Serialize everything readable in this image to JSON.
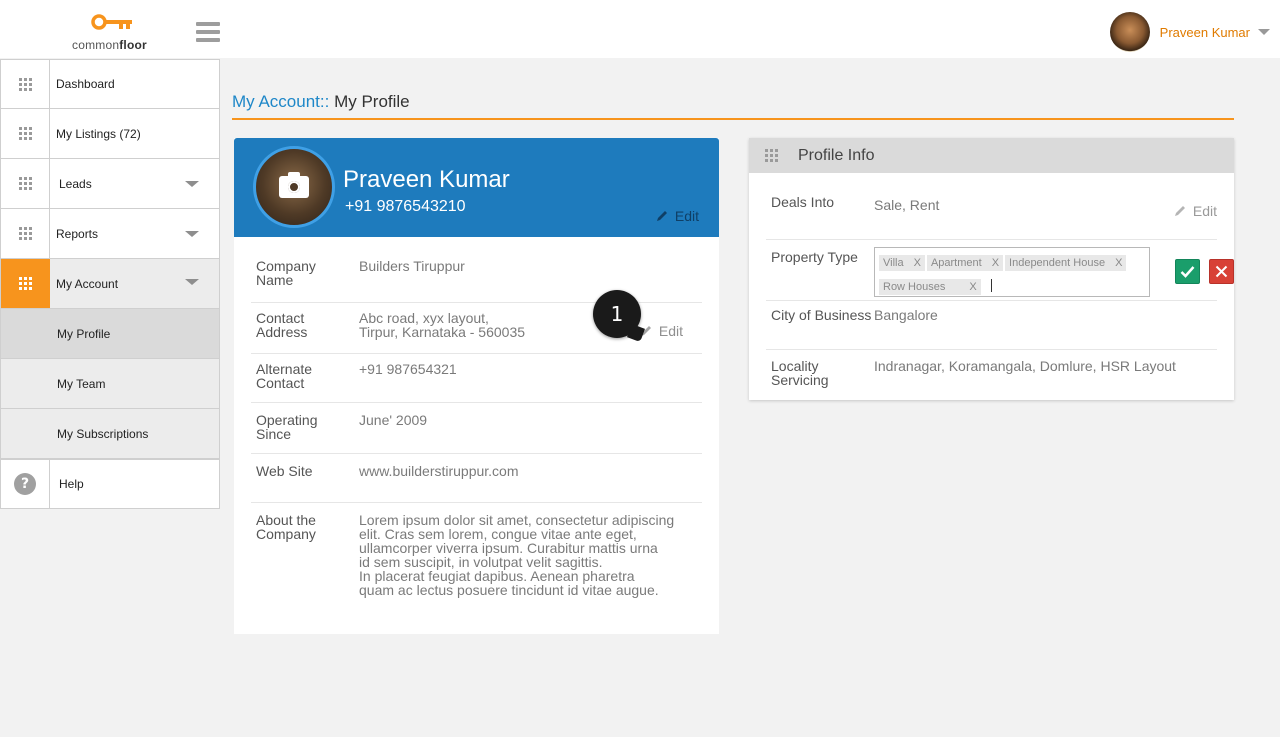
{
  "brand": {
    "logo_prefix": "common",
    "logo_suffix": "floor",
    "accent": "#f7941d",
    "primary": "#1e7bbd"
  },
  "user": {
    "name": "Praveen Kumar"
  },
  "sidebar": {
    "items": [
      {
        "label": "Dashboard",
        "icon": "grid-icon"
      },
      {
        "label": "My Listings (72)",
        "icon": "grid-icon"
      },
      {
        "label": "Leads",
        "icon": "grid-icon"
      },
      {
        "label": "Reports",
        "icon": "grid-icon"
      },
      {
        "label": "My Account",
        "icon": "grid-icon"
      }
    ],
    "subitems": [
      "My Profile",
      "My Team",
      "My Subscriptions"
    ],
    "help": {
      "label": "Help",
      "icon_glyph": "?"
    }
  },
  "page": {
    "crumb": "My Account::",
    "title": "My Profile"
  },
  "profile": {
    "name": "Praveen Kumar",
    "phone": "+91 9876543210",
    "edit_label": "Edit",
    "rows": [
      {
        "label": "Company Name",
        "value": [
          "Builders Tiruppur"
        ]
      },
      {
        "label": "Contact Address",
        "value": [
          "Abc road, xyx layout,",
          "Tirpur, Karnataka - 560035"
        ]
      },
      {
        "label": "Alternate Contact",
        "value": [
          "+91 987654321"
        ]
      },
      {
        "label": "Operating Since",
        "value": [
          "June' 2009"
        ]
      },
      {
        "label": "Web Site",
        "value": [
          "www.builderstiruppur.com"
        ]
      },
      {
        "label": "About the Company",
        "value": [
          "Lorem ipsum dolor sit amet, consectetur adipiscing",
          "elit. Cras sem lorem, congue vitae ante eget,",
          "ullamcorper viverra ipsum. Curabitur mattis urna",
          "id sem suscipit, in volutpat velit sagittis.",
          "In placerat feugiat dapibus. Aenean pharetra",
          "quam ac lectus posuere tincidunt id vitae augue."
        ]
      }
    ],
    "badge": "1"
  },
  "info": {
    "title": "Profile Info",
    "edit_label": "Edit",
    "deals_into": {
      "label": "Deals Into",
      "value": "Sale, Rent"
    },
    "property_type": {
      "label": "Property Type",
      "tags": [
        "Villa",
        "Apartment",
        "Independent House",
        "Row Houses"
      ],
      "remove_glyph": "X"
    },
    "city": {
      "label": "City of Business",
      "value": "Bangalore"
    },
    "locality": {
      "label": "Locality Servicing",
      "value": "Indranagar, Koramangala, Domlure, HSR Layout"
    }
  }
}
